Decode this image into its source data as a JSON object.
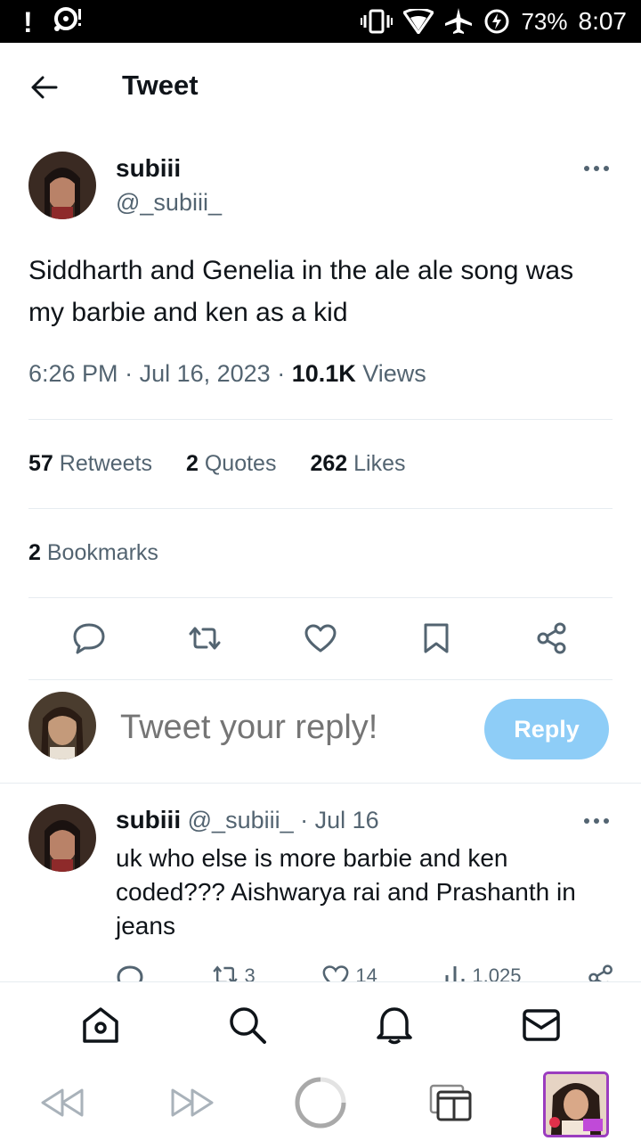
{
  "status_bar": {
    "battery": "73%",
    "time": "8:07",
    "icons": [
      "alert-icon",
      "media-icon",
      "vibrate-icon",
      "wifi-icon",
      "airplane-icon",
      "battery-charging-icon"
    ]
  },
  "header": {
    "title": "Tweet",
    "back_icon": "arrow-left-icon"
  },
  "tweet": {
    "author_name": "subiii",
    "author_handle": "@_subiii_",
    "text": "Siddharth and Genelia in the ale ale song was my barbie and ken as a kid",
    "time": "6:26 PM",
    "date": "Jul 16, 2023",
    "views_count": "10.1K",
    "views_label": "Views",
    "retweets_count": "57",
    "retweets_label": "Retweets",
    "quotes_count": "2",
    "quotes_label": "Quotes",
    "likes_count": "262",
    "likes_label": "Likes",
    "bookmarks_count": "2",
    "bookmarks_label": "Bookmarks"
  },
  "reply_box": {
    "placeholder": "Tweet your reply!",
    "button_label": "Reply"
  },
  "reply": {
    "author_name": "subiii",
    "author_handle": "@_subiii_",
    "separator": "·",
    "date": "Jul 16",
    "text": "uk who else is more barbie and ken coded??? Aishwarya rai and Prashanth in jeans",
    "retweets": "3",
    "likes": "14",
    "views": "1,025"
  },
  "bottom_nav": [
    "home-icon",
    "search-icon",
    "notifications-icon",
    "messages-icon"
  ],
  "browser_bar": [
    "rewind-icon",
    "fast-forward-icon",
    "loading-icon",
    "tabs-icon",
    "profile-thumbnail"
  ],
  "colors": {
    "reply_button": "#8ecdf7",
    "muted_text": "#536471",
    "primary_text": "#0f1419"
  }
}
